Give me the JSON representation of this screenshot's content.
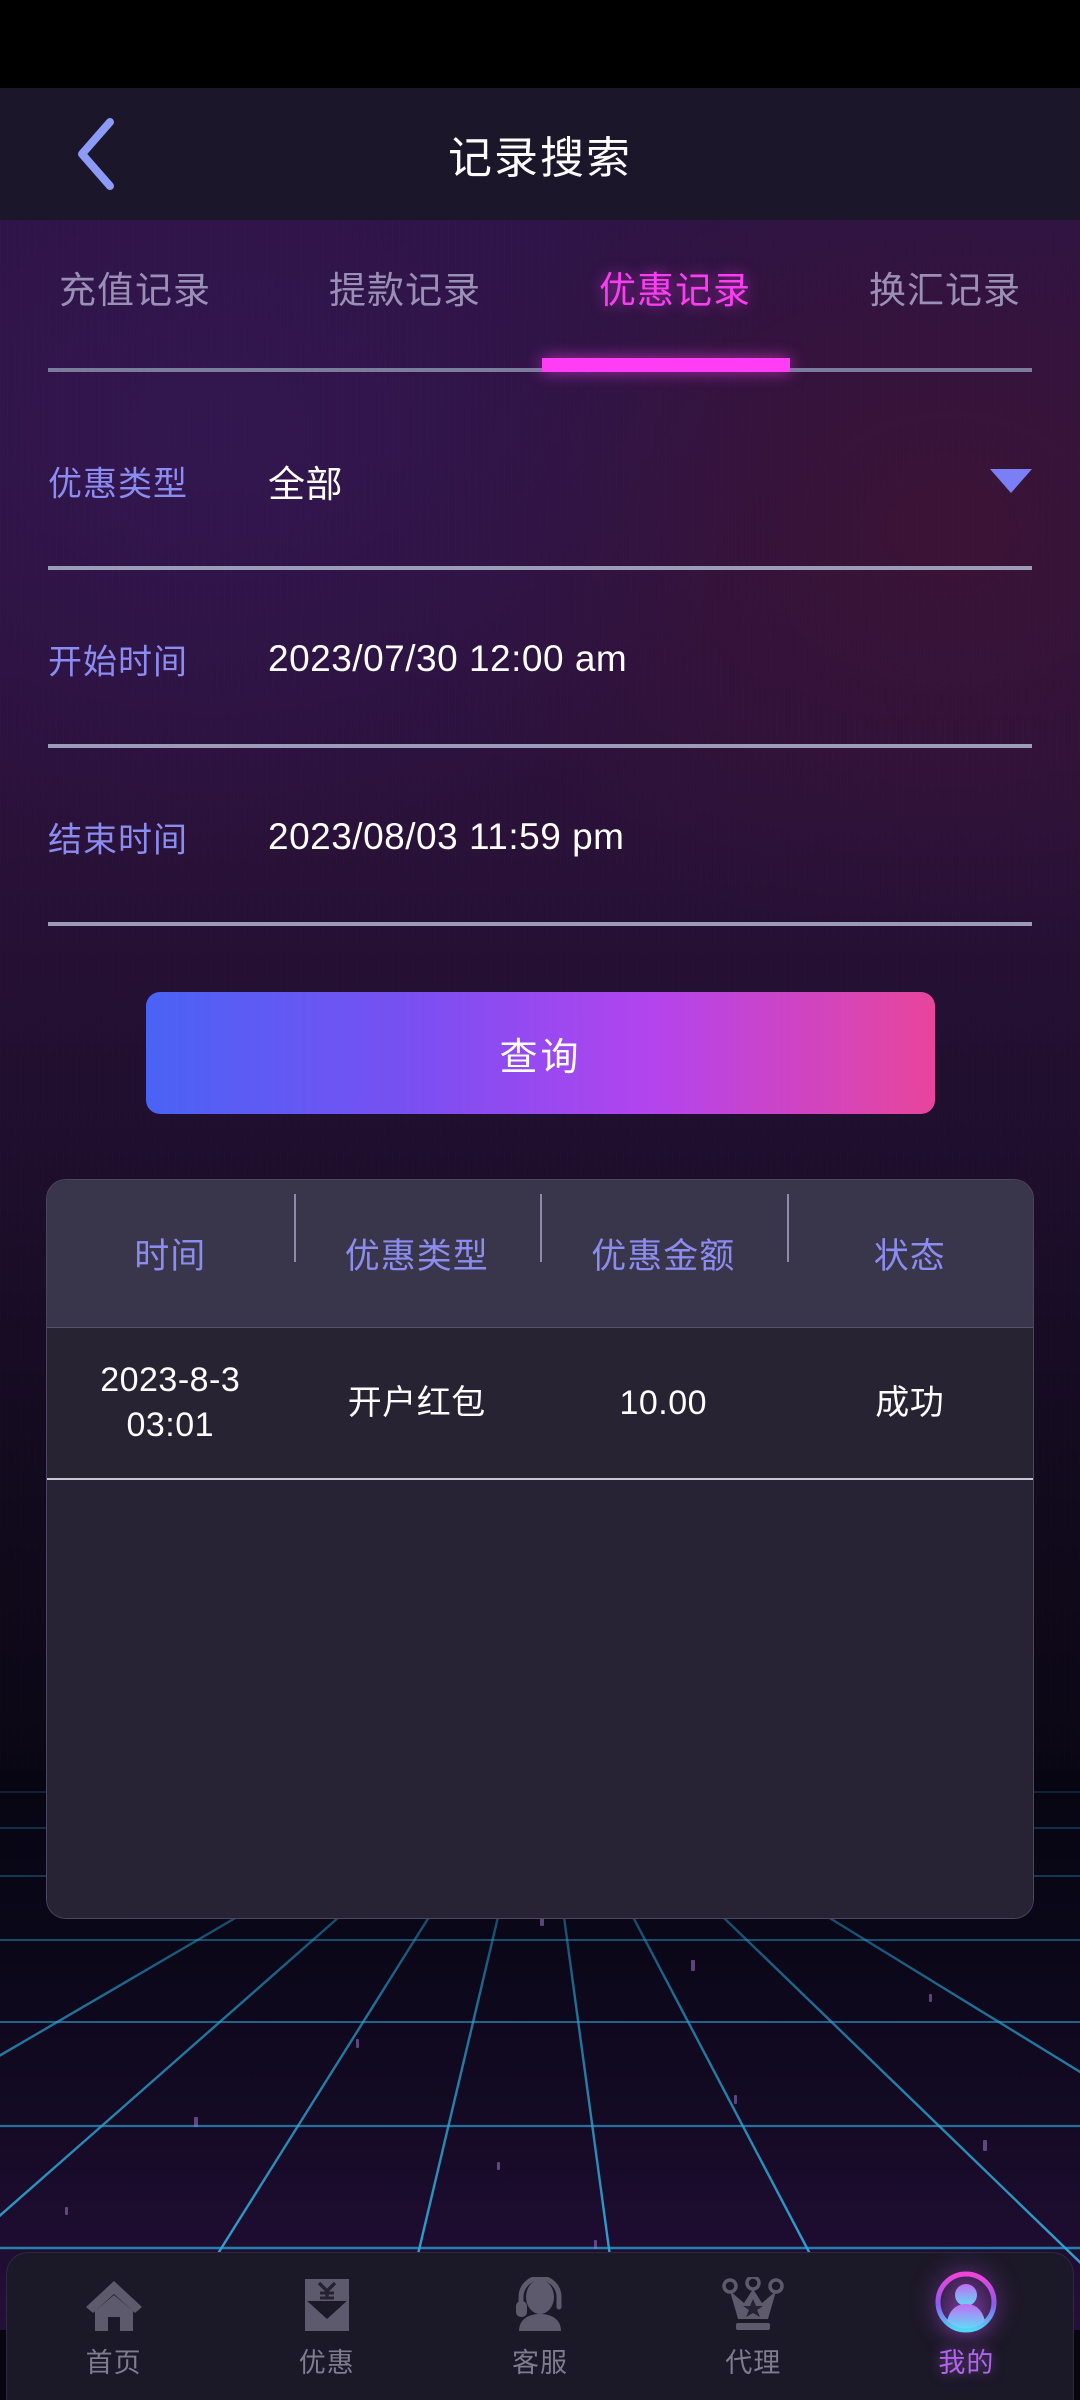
{
  "header": {
    "title": "记录搜索",
    "back_icon": "chevron-left-icon"
  },
  "tabs": [
    {
      "label": "充值记录",
      "active": false
    },
    {
      "label": "提款记录",
      "active": false
    },
    {
      "label": "优惠记录",
      "active": true
    },
    {
      "label": "换汇记录",
      "active": false
    }
  ],
  "form": {
    "fields": [
      {
        "label": "优惠类型",
        "value": "全部",
        "has_caret": true
      },
      {
        "label": "开始时间",
        "value": "2023/07/30 12:00 am",
        "has_caret": false
      },
      {
        "label": "结束时间",
        "value": "2023/08/03 11:59 pm",
        "has_caret": false
      }
    ],
    "submit_label": "查询"
  },
  "results": {
    "columns": [
      "时间",
      "优惠类型",
      "优惠金额",
      "状态"
    ],
    "rows": [
      {
        "time": "2023-8-3\n03:01",
        "type": "开户红包",
        "amount": "10.00",
        "status": "成功"
      }
    ]
  },
  "bottom_nav": [
    {
      "label": "首页",
      "icon": "home-icon",
      "active": false
    },
    {
      "label": "优惠",
      "icon": "red-envelope-icon",
      "active": false
    },
    {
      "label": "客服",
      "icon": "headset-support-icon",
      "active": false
    },
    {
      "label": "代理",
      "icon": "crown-icon",
      "active": false
    },
    {
      "label": "我的",
      "icon": "user-avatar-icon",
      "active": true
    }
  ],
  "colors": {
    "accent_magenta": "#ff3df5",
    "accent_periwinkle": "#8b8cf0",
    "button_gradient_start": "#4a63f5",
    "button_gradient_end": "#e8459b",
    "background_purple": "#2c1448",
    "grid_cyan": "#2aa7d8"
  }
}
